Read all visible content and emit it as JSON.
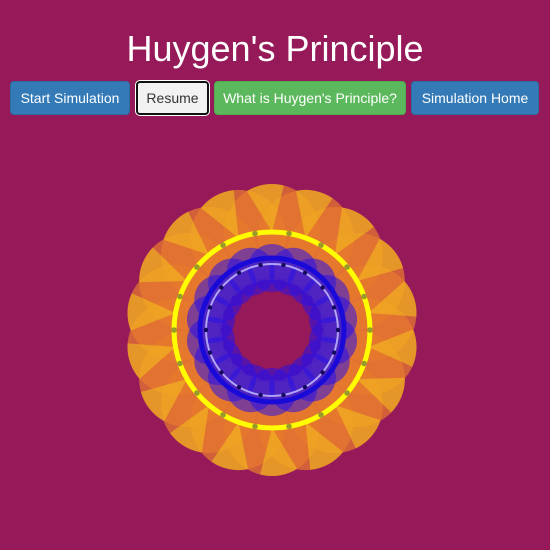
{
  "page": {
    "title": "Huygen's Principle",
    "background_color": "#961a5a"
  },
  "toolbar": {
    "start_label": "Start Simulation",
    "resume_label": "Resume",
    "what_label": "What is Huygen's Principle?",
    "home_label": "Simulation Home"
  },
  "simulation": {
    "outer_wavelet_count": 18,
    "inner_wavelet_count": 18,
    "colors": {
      "outer_wavelet": "#e87a2e",
      "outer_wavelet_highlight": "#f5c21c",
      "outer_wavefront": "#ffff00",
      "inner_wavelet": "#2a10e6",
      "inner_wavefront": "#1a0ad8",
      "inner_wavefront_highlight": "#c8c4ff",
      "source_dot": "#9a9a2a"
    }
  }
}
